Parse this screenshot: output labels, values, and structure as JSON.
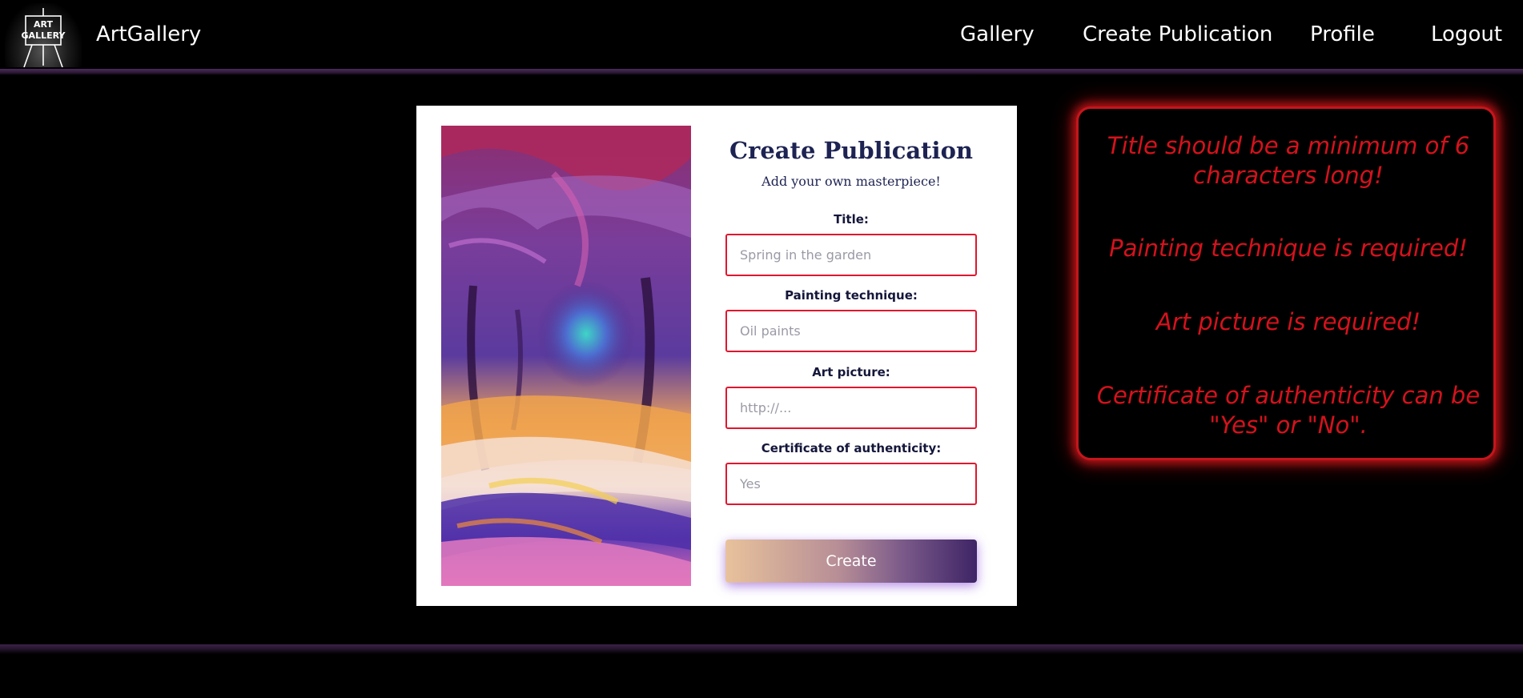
{
  "header": {
    "logo_text_line1": "ART",
    "logo_text_line2": "GALLERY",
    "brand": "ArtGallery",
    "nav": [
      "Gallery",
      "Create Publication",
      "Profile",
      "Logout"
    ]
  },
  "form": {
    "title": "Create Publication",
    "subtitle": "Add your own masterpiece!",
    "fields": [
      {
        "label": "Title:",
        "placeholder": "Spring in the garden",
        "value": ""
      },
      {
        "label": "Painting technique:",
        "placeholder": "Oil paints",
        "value": ""
      },
      {
        "label": "Art picture:",
        "placeholder": "http://...",
        "value": ""
      },
      {
        "label": "Certificate of authenticity:",
        "placeholder": "Yes",
        "value": ""
      }
    ],
    "submit_label": "Create"
  },
  "errors": [
    "Title should be a minimum of 6 characters long!",
    "Painting technique is required!",
    "Art picture is required!",
    "Certificate of authenticity can be \"Yes\" or \"No\"."
  ],
  "colors": {
    "error_red": "#d5121c",
    "form_title": "#1d2352",
    "input_border": "#e0162f",
    "accent_purple": "#3e2466"
  },
  "icons": {
    "logo": "art-gallery-easel-logo"
  }
}
